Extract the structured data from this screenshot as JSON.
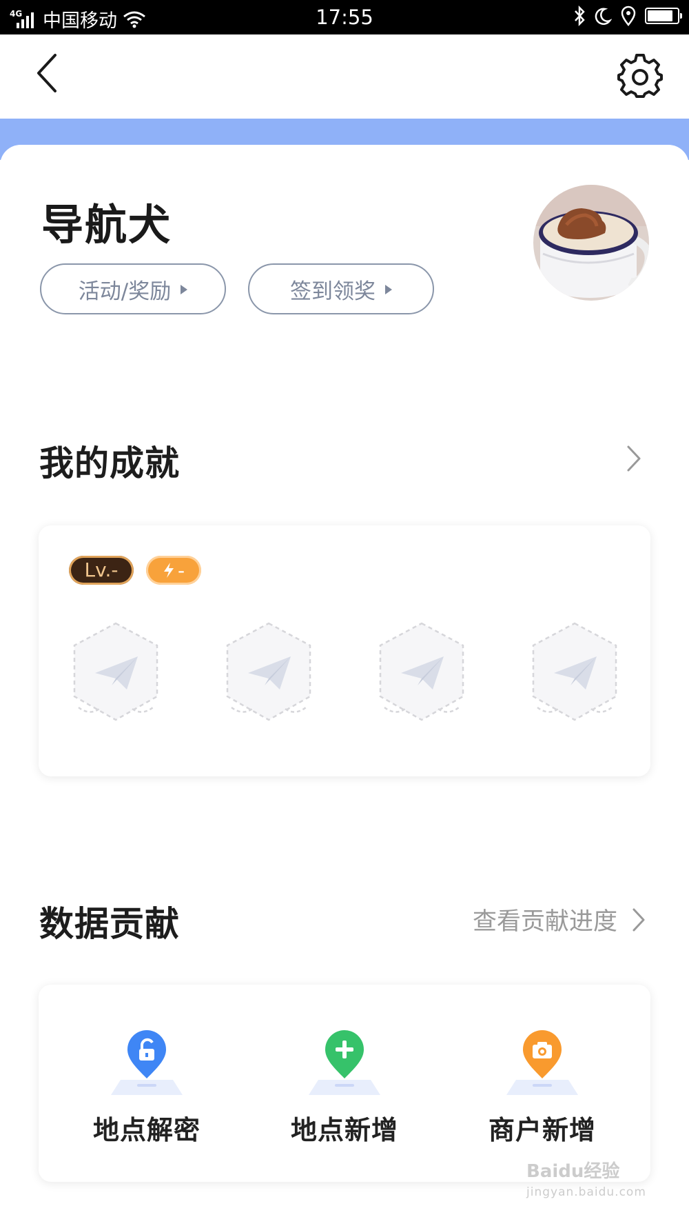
{
  "status_bar": {
    "network": "4G",
    "carrier": "中国移动",
    "time": "17:55",
    "icons": [
      "signal-icon",
      "wifi-icon",
      "bluetooth-icon",
      "moon-icon",
      "location-icon",
      "battery-icon"
    ]
  },
  "header": {
    "back_icon": "chevron-left-icon",
    "settings_icon": "gear-icon"
  },
  "profile": {
    "username": "导航犬",
    "buttons": [
      {
        "label": "活动/奖励"
      },
      {
        "label": "签到领奖"
      }
    ],
    "avatar": "coffee-cup-avatar"
  },
  "achievements": {
    "title": "我的成就",
    "level_badge": "Lv.-",
    "energy_badge": "-",
    "medal_count": 4,
    "medal_icon": "paper-plane-icon"
  },
  "contribution": {
    "title": "数据贡献",
    "progress_link": "查看贡献进度",
    "items": [
      {
        "label": "地点解密",
        "icon": "unlock-pin-icon",
        "color": "#3f86f5"
      },
      {
        "label": "地点新增",
        "icon": "plus-pin-icon",
        "color": "#36c26a"
      },
      {
        "label": "商户新增",
        "icon": "camera-pin-icon",
        "color": "#f99a2e"
      }
    ]
  },
  "watermark": {
    "brand": "Baidu经验",
    "url": "jingyan.baidu.com"
  },
  "colors": {
    "band_blue": "#8fb1f8",
    "pill_border": "#8a96aa",
    "level_bg": "#3c2414",
    "energy_bg": "#f8a23b"
  }
}
